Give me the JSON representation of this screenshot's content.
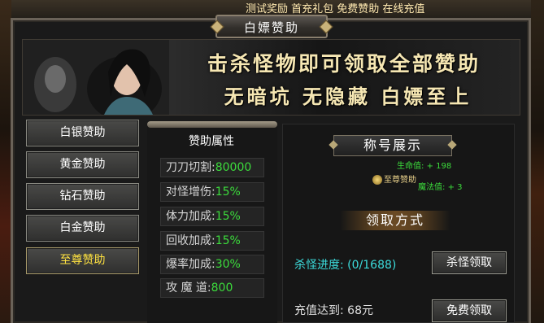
{
  "ticker": {
    "text": "测试奖励 首充礼包 免费赞助 在线充值"
  },
  "window": {
    "title": "白嫖赞助"
  },
  "banner": {
    "line1": "击杀怪物即可领取全部赞助",
    "line2": "无暗坑 无隐藏 白嫖至上"
  },
  "sidebar": {
    "items": [
      {
        "label": "白银赞助"
      },
      {
        "label": "黄金赞助"
      },
      {
        "label": "钻石赞助"
      },
      {
        "label": "白金赞助"
      },
      {
        "label": "至尊赞助"
      }
    ],
    "active": "至尊赞助"
  },
  "attributes": {
    "title": "赞助属性",
    "rows": [
      {
        "label": "刀刀切割:",
        "value": "80000"
      },
      {
        "label": "对怪增伤:",
        "value": "15%"
      },
      {
        "label": "体力加成:",
        "value": "15%"
      },
      {
        "label": "回收加成:",
        "value": "15%"
      },
      {
        "label": "爆率加成:",
        "value": "30%"
      },
      {
        "label": "攻 魔 道:",
        "value": "800"
      }
    ]
  },
  "title_display": {
    "heading": "称号展示",
    "badge_name": "至尊赞助",
    "hp_label": "生命值:",
    "hp_value": "+ 198",
    "mp_label": "魔法值:",
    "mp_value": "+ 3"
  },
  "claim": {
    "heading": "领取方式",
    "kill_label": "杀怪进度:",
    "kill_value": "(0/1688)",
    "kill_button": "杀怪领取",
    "recharge_label": "充值达到:",
    "recharge_value": "68元",
    "free_button": "免费领取"
  },
  "colors": {
    "accent_green": "#3cdc3c",
    "accent_yellow": "#ffe240",
    "banner_text": "#f6e7b3"
  }
}
